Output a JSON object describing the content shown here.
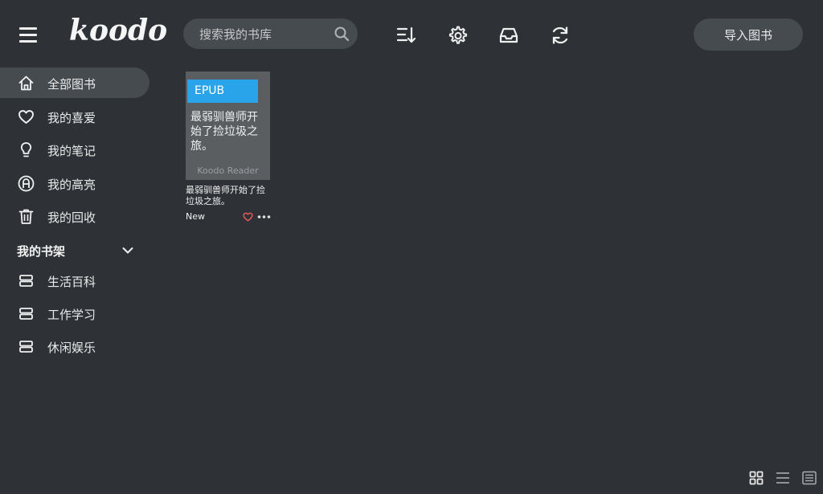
{
  "header": {
    "logo_text": "koodo",
    "search_placeholder": "搜索我的书库",
    "import_label": "导入图书"
  },
  "sidebar": {
    "items": [
      {
        "label": "全部图书",
        "icon": "home-icon",
        "active": true
      },
      {
        "label": "我的喜爱",
        "icon": "heart-icon",
        "active": false
      },
      {
        "label": "我的笔记",
        "icon": "lightbulb-icon",
        "active": false
      },
      {
        "label": "我的高亮",
        "icon": "highlight-icon",
        "active": false
      },
      {
        "label": "我的回收",
        "icon": "trash-icon",
        "active": false
      }
    ],
    "shelf_title": "我的书架",
    "shelves": [
      {
        "label": "生活百科",
        "icon": "shelf-icon"
      },
      {
        "label": "工作学习",
        "icon": "shelf-icon"
      },
      {
        "label": "休闲娱乐",
        "icon": "shelf-icon"
      }
    ]
  },
  "books": [
    {
      "format": "EPUB",
      "cover_title": "最弱驯兽师开始了捡垃圾之旅。",
      "publisher": "Koodo Reader",
      "title": "最弱驯兽师开始了捡垃圾之旅。",
      "progress": "New"
    }
  ],
  "colors": {
    "background": "#2e3236",
    "panel": "#464b50",
    "accent": "#29a3ea",
    "heart": "#e05a5a"
  },
  "view_modes": [
    "grid-view-icon",
    "list-view-icon",
    "cover-view-icon"
  ]
}
